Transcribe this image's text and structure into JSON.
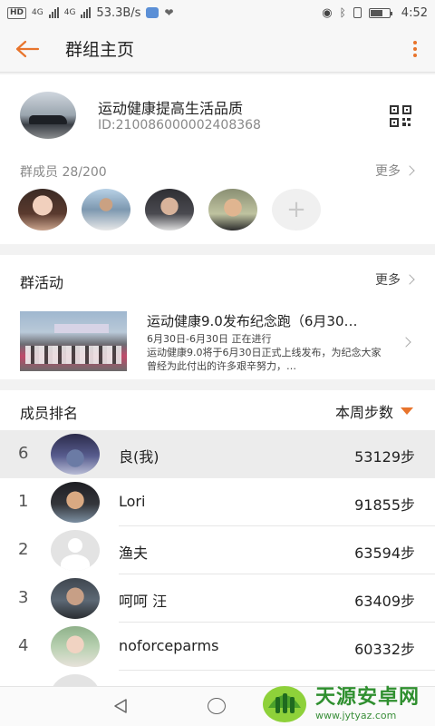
{
  "status_bar": {
    "hd": "HD",
    "net1": "4G",
    "net2": "4G",
    "speed": "53.3B/s",
    "time": "4:52"
  },
  "header": {
    "title": "群组主页"
  },
  "group": {
    "name": "运动健康提高生活品质",
    "id": "ID:210086000002408368",
    "members_label": "群成员 28/200",
    "more_label": "更多"
  },
  "activities": {
    "title": "群活动",
    "more_label": "更多",
    "item": {
      "title": "运动健康9.0发布纪念跑（6月30…",
      "date": "6月30日-6月30日 正在进行",
      "desc": "运动健康9.0将于6月30日正式上线发布，为纪念大家曾经为此付出的许多艰辛努力，…"
    }
  },
  "ranking": {
    "title": "成员排名",
    "sort_label": "本周步数",
    "rows": [
      {
        "rank": "6",
        "name": "良(我)",
        "steps": "53129步"
      },
      {
        "rank": "1",
        "name": "Lori",
        "steps": "91855步"
      },
      {
        "rank": "2",
        "name": "渔夫",
        "steps": "63594步"
      },
      {
        "rank": "3",
        "name": "呵呵 汪",
        "steps": "63409步"
      },
      {
        "rank": "4",
        "name": "noforceparms",
        "steps": "60332步"
      }
    ]
  },
  "watermark": {
    "cn": "天源安卓网",
    "url": "www.jytyaz.com"
  },
  "colors": {
    "accent": "#e8742c",
    "background": "#f2f2f2"
  }
}
